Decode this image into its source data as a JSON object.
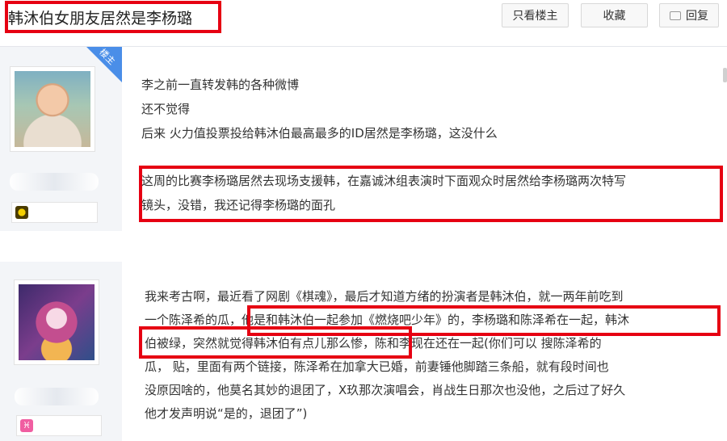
{
  "thread": {
    "title": "韩沐伯女朋友居然是李杨璐"
  },
  "toolbar": {
    "only_op_label": "只看楼主",
    "favorite_label": "收藏",
    "reply_label": "回复"
  },
  "post1": {
    "op_badge": "楼主",
    "lines": [
      "李之前一直转发韩的各种微博",
      "还不觉得",
      "后来 火力值投票投给韩沐伯最高最多的ID居然是李杨璐，这没什么",
      "这周的比赛李杨璐居然去现场支援韩，在嘉诚沐组表演时下面观众时居然给李杨璐两次特写",
      "镜头，没错，我还记得李杨璐的面孔"
    ]
  },
  "post2": {
    "badge_symbol": "♓",
    "lines": [
      "我来考古啊，最近看了网剧《棋魂》，最后才知道方绪的扮演者是韩沐伯，就一两年前吃到",
      "一个陈泽希的瓜，他是和韩沐伯一起参加《燃烧吧少年》的，李杨璐和陈泽希在一起，韩沐",
      "伯被绿，突然就觉得韩沐伯有点儿那么惨，陈和李现在还在一起(你们可以 搜陈泽希的",
      "瓜， 贴，里面有两个链接，陈泽希在加拿大已婚，前妻锤他脚踏三条船，就有段时间也",
      "没原因啥的，他莫名其妙的退团了，X玖那次演唱会，肖战生日那次也没他，之后过了好久",
      "他才发声明说“是的，退团了”)"
    ]
  }
}
